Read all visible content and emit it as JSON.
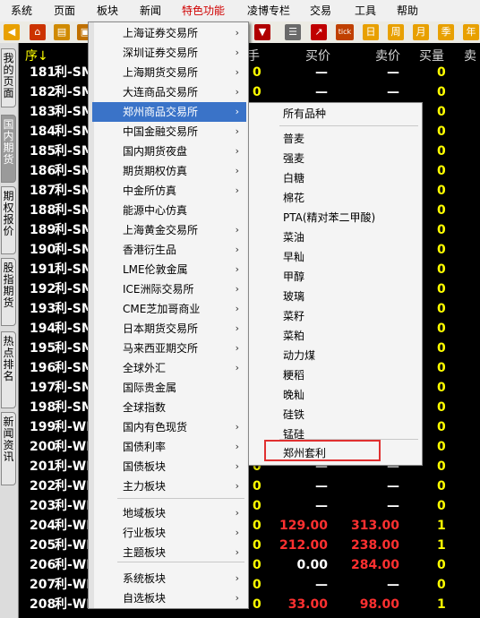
{
  "menubar": [
    "系统",
    "页面",
    "板块",
    "新闻",
    "特色功能",
    "凌博专栏",
    "交易",
    "工具",
    "帮助"
  ],
  "active_menu": "特色功能",
  "toolbar": {
    "icons": [
      "back-arrow-icon",
      "home-icon",
      "book-icon",
      "filter-icon",
      "list-view-icon",
      "chart-icon",
      "tick-icon",
      "day-icon",
      "week-icon",
      "month-icon",
      "quarter-icon",
      "year-icon"
    ],
    "labels": {
      "tick": "tick",
      "day": "日",
      "week": "周",
      "month": "月",
      "quarter": "季",
      "year": "年"
    }
  },
  "sidetabs": [
    "我的页面",
    "国内期货",
    "期权报价",
    "股指期货",
    "热点排名",
    "新闻资讯"
  ],
  "columns": {
    "seq": "序",
    "shou": "手",
    "buy": "买价",
    "sell": "卖价",
    "buyvol": "买量",
    "sellq": "卖"
  },
  "rows": [
    {
      "seq": "181",
      "name": "利-SM",
      "shou": "0",
      "buy": "—",
      "sell": "—",
      "vol": "0"
    },
    {
      "seq": "182",
      "name": "利-SM",
      "shou": "0",
      "buy": "—",
      "sell": "—",
      "vol": "0"
    },
    {
      "seq": "183",
      "name": "利-SM",
      "shou": "0",
      "buy": "—",
      "sell": "—",
      "vol": "0"
    },
    {
      "seq": "184",
      "name": "利-SM",
      "shou": "0",
      "buy": "—",
      "sell": "—",
      "vol": "0"
    },
    {
      "seq": "185",
      "name": "利-SM",
      "shou": "0",
      "buy": "—",
      "sell": "—",
      "vol": "0"
    },
    {
      "seq": "186",
      "name": "利-SM",
      "shou": "0",
      "buy": "—",
      "sell": "—",
      "vol": "0"
    },
    {
      "seq": "187",
      "name": "利-SM",
      "shou": "0",
      "buy": "—",
      "sell": "—",
      "vol": "0"
    },
    {
      "seq": "188",
      "name": "利-SM",
      "shou": "0",
      "buy": "—",
      "sell": "—",
      "vol": "0"
    },
    {
      "seq": "189",
      "name": "利-SM",
      "shou": "0",
      "buy": "—",
      "sell": "—",
      "vol": "0"
    },
    {
      "seq": "190",
      "name": "利-SM",
      "shou": "0",
      "buy": "—",
      "sell": "—",
      "vol": "0"
    },
    {
      "seq": "191",
      "name": "利-SM",
      "shou": "0",
      "buy": "—",
      "sell": "—",
      "vol": "0"
    },
    {
      "seq": "192",
      "name": "利-SM",
      "shou": "0",
      "buy": "—",
      "sell": "—",
      "vol": "0"
    },
    {
      "seq": "193",
      "name": "利-SM",
      "shou": "0",
      "buy": "—",
      "sell": "—",
      "vol": "0"
    },
    {
      "seq": "194",
      "name": "利-SM",
      "shou": "0",
      "buy": "—",
      "sell": "—",
      "vol": "0"
    },
    {
      "seq": "195",
      "name": "利-SM",
      "shou": "0",
      "buy": "—",
      "sell": "—",
      "vol": "0"
    },
    {
      "seq": "196",
      "name": "利-SM",
      "shou": "0",
      "buy": "—",
      "sell": "—",
      "vol": "0"
    },
    {
      "seq": "197",
      "name": "利-SM",
      "shou": "0",
      "buy": "—",
      "sell": "—",
      "vol": "0"
    },
    {
      "seq": "198",
      "name": "利-SM",
      "shou": "0",
      "buy": "—",
      "sell": "—",
      "vol": "0"
    },
    {
      "seq": "199",
      "name": "利-WH",
      "shou": "0",
      "buy": "—",
      "sell": "—",
      "vol": "0"
    },
    {
      "seq": "200",
      "name": "利-WH",
      "shou": "0",
      "buy": "—",
      "sell": "—",
      "vol": "0"
    },
    {
      "seq": "201",
      "name": "利-WH",
      "shou": "0",
      "buy": "—",
      "sell": "—",
      "vol": "0"
    },
    {
      "seq": "202",
      "name": "利-WH",
      "shou": "0",
      "buy": "—",
      "sell": "—",
      "vol": "0"
    },
    {
      "seq": "203",
      "name": "利-WH",
      "shou": "0",
      "buy": "—",
      "sell": "—",
      "vol": "0"
    },
    {
      "seq": "204",
      "name": "利-WH",
      "shou": "0",
      "buy": "129.00",
      "sell": "313.00",
      "vol": "1",
      "buyRed": true,
      "sellRed": true
    },
    {
      "seq": "205",
      "name": "利-WH",
      "shou": "0",
      "buy": "212.00",
      "sell": "238.00",
      "vol": "1",
      "buyRed": true,
      "sellRed": true
    },
    {
      "seq": "206",
      "name": "利-WH",
      "shou": "0",
      "buy": "0.00",
      "sell": "284.00",
      "vol": "0",
      "buyRed": false,
      "sellRed": true
    },
    {
      "seq": "207",
      "name": "利-WH",
      "shou": "0",
      "buy": "—",
      "sell": "—",
      "vol": "0"
    },
    {
      "seq": "208",
      "name": "利-WH",
      "shou": "0",
      "buy": "33.00",
      "sell": "98.00",
      "vol": "1",
      "buyRed": true,
      "sellRed": true
    }
  ],
  "menu1": [
    {
      "label": "上海证券交易所",
      "arrow": true
    },
    {
      "label": "深圳证券交易所",
      "arrow": true
    },
    {
      "label": "上海期货交易所",
      "arrow": true
    },
    {
      "label": "大连商品交易所",
      "arrow": true
    },
    {
      "label": "郑州商品交易所",
      "arrow": true,
      "highlight": true
    },
    {
      "label": "中国金融交易所",
      "arrow": true
    },
    {
      "label": "国内期货夜盘",
      "arrow": true
    },
    {
      "label": "期货期权仿真",
      "arrow": true
    },
    {
      "label": "中金所仿真",
      "arrow": true
    },
    {
      "label": "能源中心仿真",
      "arrow": false
    },
    {
      "label": "上海黄金交易所",
      "arrow": true
    },
    {
      "label": "香港衍生品",
      "arrow": true
    },
    {
      "label": "LME伦敦金属",
      "arrow": true
    },
    {
      "label": "ICE洲际交易所",
      "arrow": true
    },
    {
      "label": "CME芝加哥商业",
      "arrow": true
    },
    {
      "label": "日本期货交易所",
      "arrow": true
    },
    {
      "label": "马来西亚期交所",
      "arrow": true
    },
    {
      "label": "全球外汇",
      "arrow": true
    },
    {
      "label": "国际贵金属",
      "arrow": false
    },
    {
      "label": "全球指数",
      "arrow": false
    },
    {
      "label": "国内有色现货",
      "arrow": true
    },
    {
      "label": "国债利率",
      "arrow": true
    },
    {
      "label": "国债板块",
      "arrow": true
    },
    {
      "label": "主力板块",
      "arrow": true
    },
    {
      "label": "地域板块",
      "arrow": true
    },
    {
      "label": "行业板块",
      "arrow": true
    },
    {
      "label": "主题板块",
      "arrow": true
    },
    {
      "label": "系统板块",
      "arrow": true
    },
    {
      "label": "自选板块",
      "arrow": true
    }
  ],
  "menu2": [
    "所有品种",
    "普麦",
    "强麦",
    "白糖",
    "棉花",
    "PTA(精对苯二甲酸)",
    "菜油",
    "早籼",
    "甲醇",
    "玻璃",
    "菜籽",
    "菜粕",
    "动力煤",
    "粳稻",
    "晚籼",
    "硅铁",
    "锰硅",
    "郑州套利"
  ],
  "menu2_highlighted": "郑州套利"
}
